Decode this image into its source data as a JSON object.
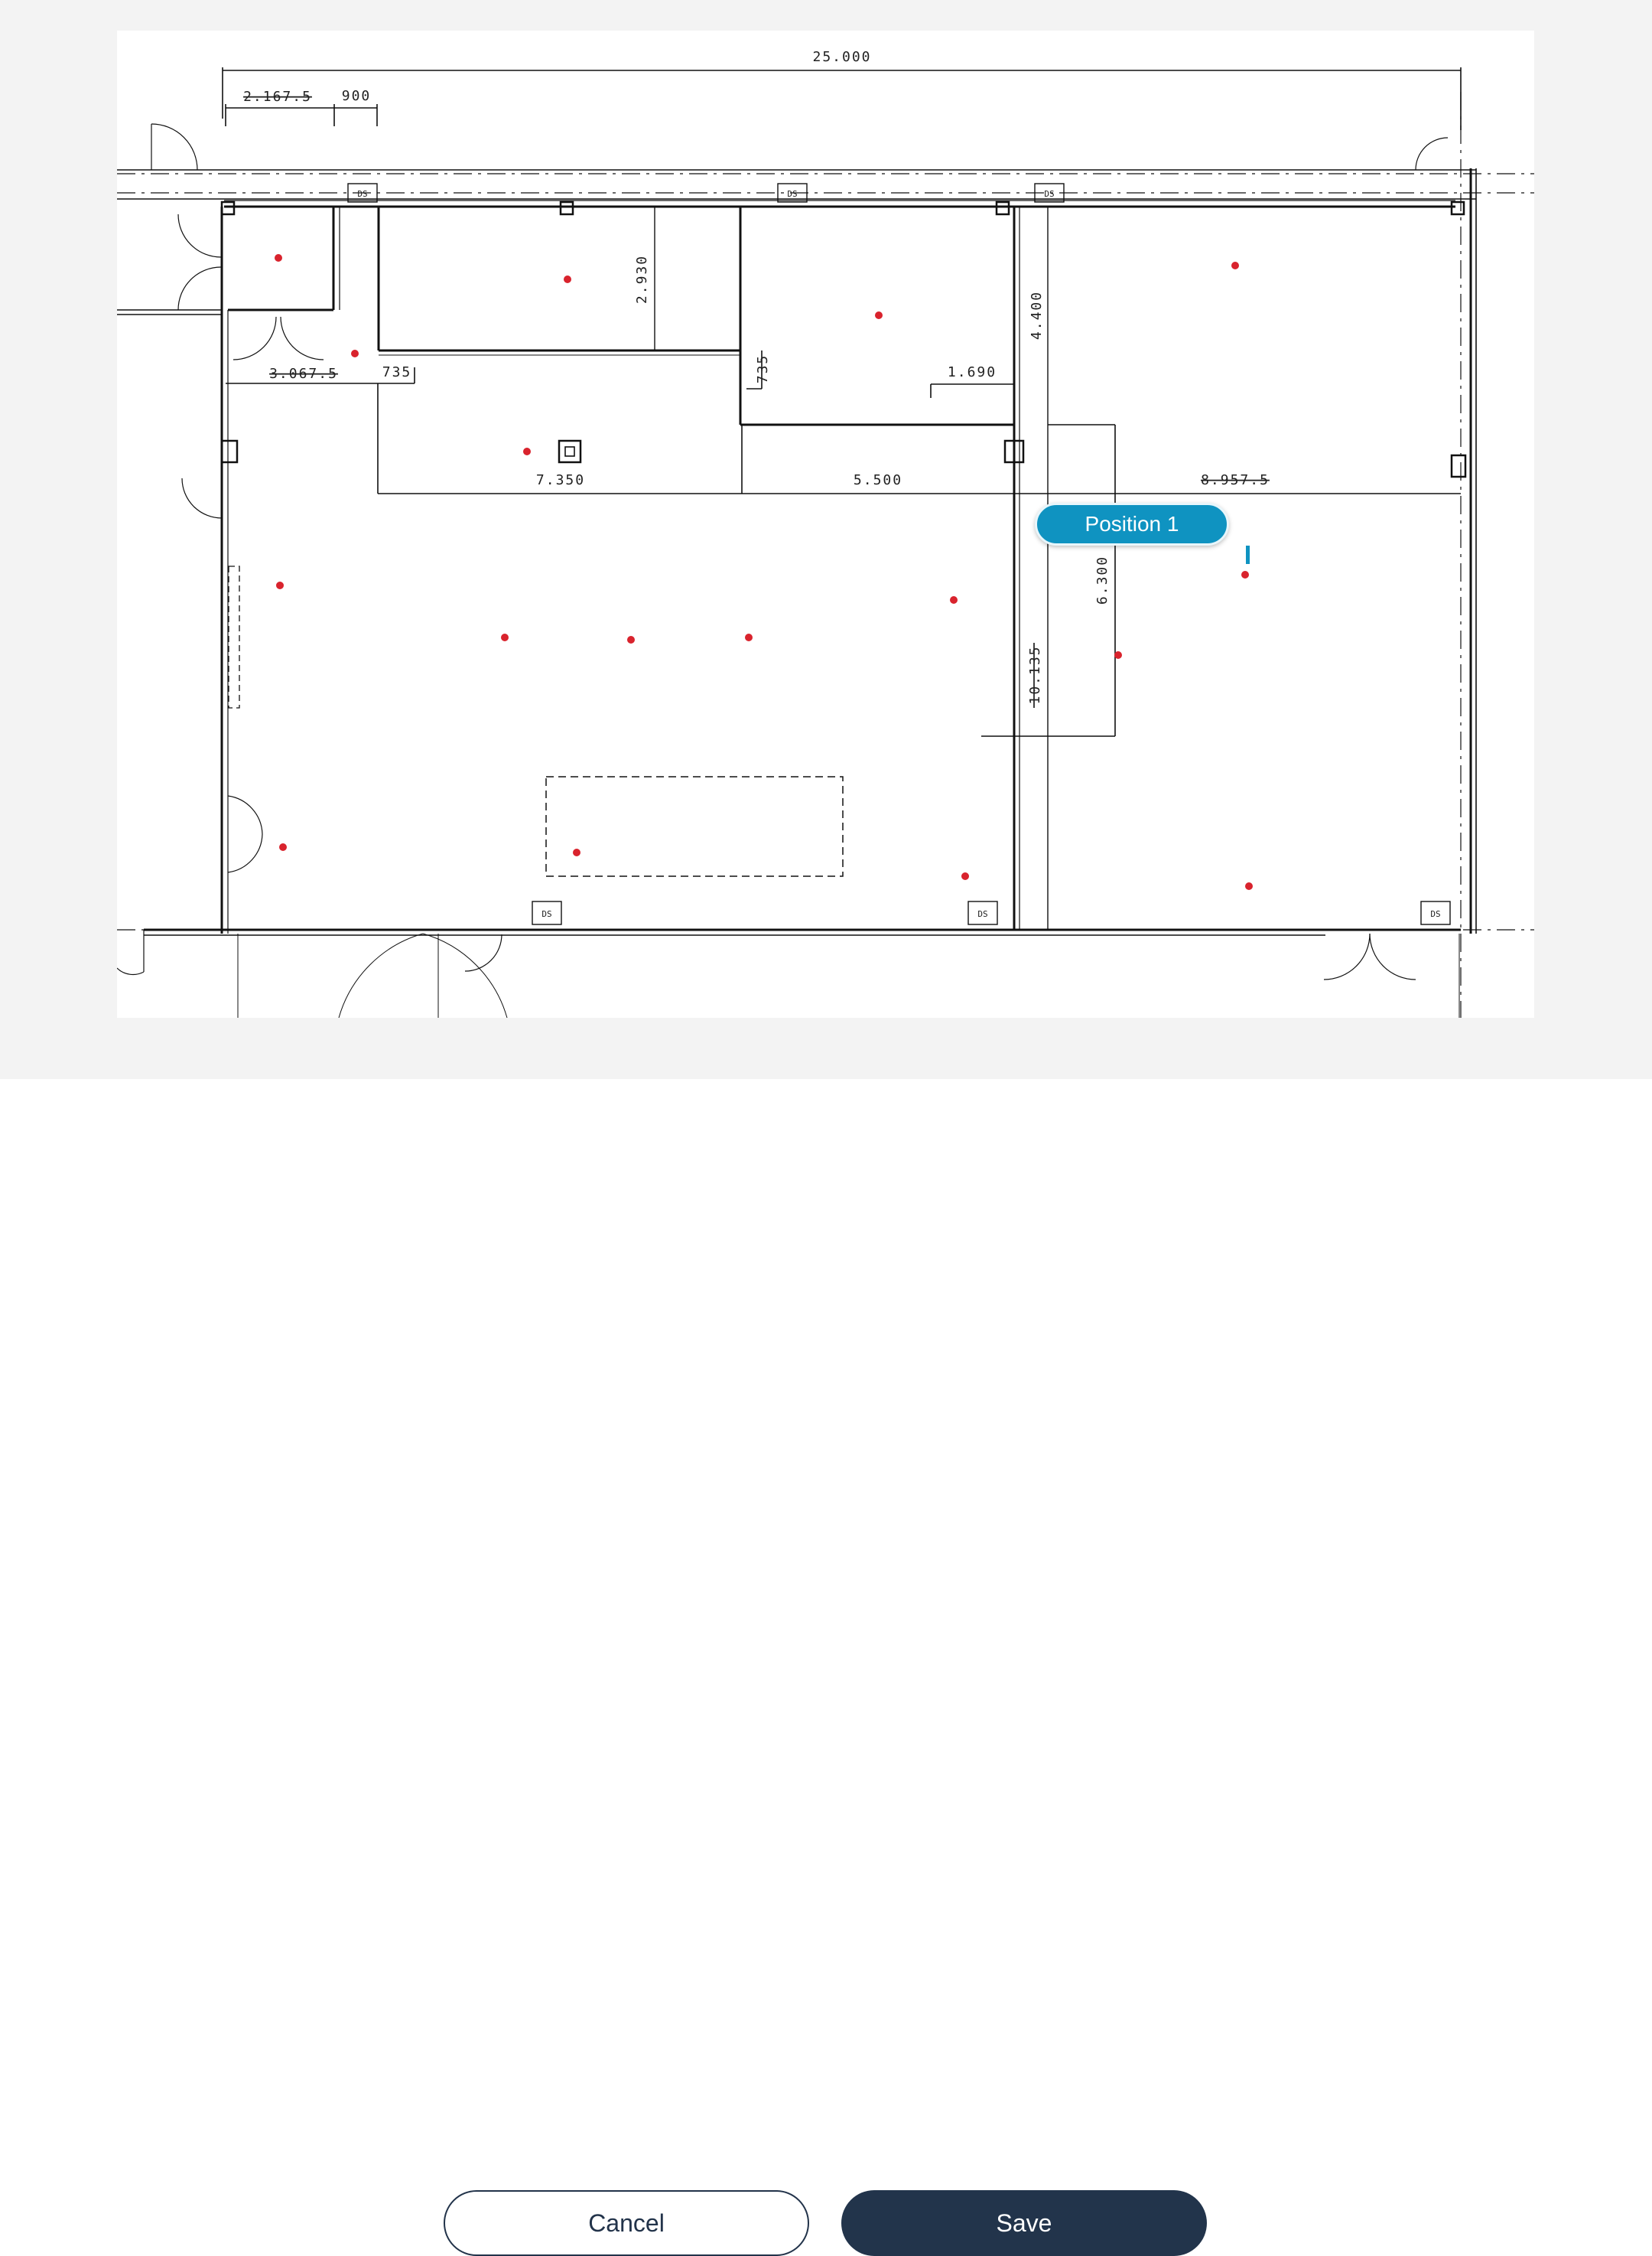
{
  "floor_plan": {
    "dimension_labels": {
      "overall_width": "25.000",
      "left_small_a": "2.167.5",
      "left_small_b": "900",
      "height_top_mid": "2.930",
      "height_right_col": "4.400",
      "width_left_room": "3.067.5",
      "small_735_h": "735",
      "small_735_v": "735",
      "width_1690": "1.690",
      "width_7350": "7.350",
      "width_5500": "5.500",
      "width_8957": "8.957.5",
      "height_6300": "6.300",
      "height_10135": "10.135",
      "ds_tag": "DS"
    },
    "sensor_color": "#d9232d",
    "sensor_count": 19,
    "marker": {
      "label": "Position 1",
      "color": "#0f93c1"
    }
  },
  "actions": {
    "cancel_label": "Cancel",
    "save_label": "Save"
  }
}
